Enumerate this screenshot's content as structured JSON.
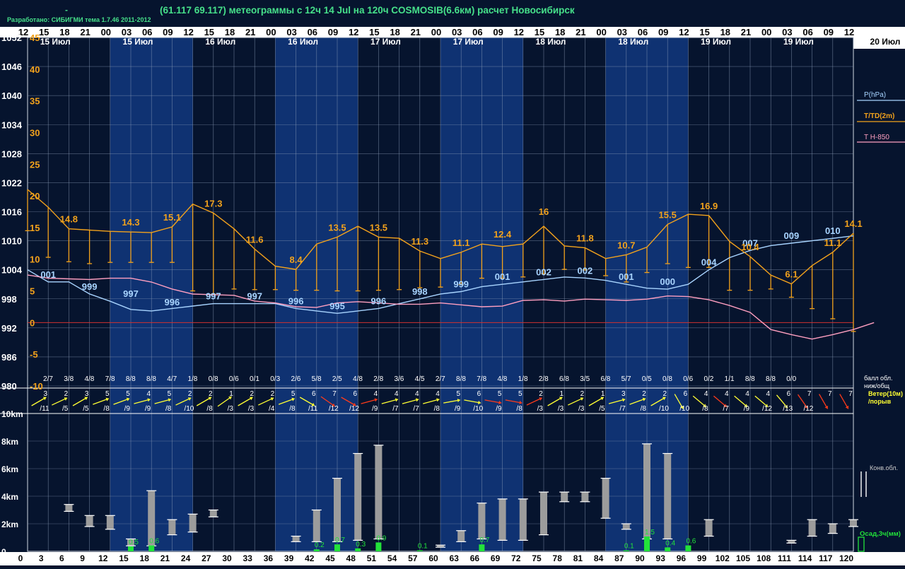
{
  "header": {
    "credit": "Разработано: СИБИГМИ тема 1.7.46 2011-2012",
    "dash": "-",
    "title": "(61.117 69.117) метеограммы с  12ч 14 Jul на 120ч COSMOSIB(6.6км) расчет Новосибирск"
  },
  "colors": {
    "background": "#06142e",
    "day_band": "#0f3272",
    "grid": "#8fa0bb",
    "pressure": "#a8d4ff",
    "temp": "#f2a21c",
    "t850": "#ff9fc0",
    "label": "#ffffff",
    "wind_normal": "#ffff33",
    "wind_strong": "#ff3b1a",
    "precip": "#22e23a",
    "cloud_bar": "#9c9c9c"
  },
  "chart_data": {
    "type": "line",
    "time_ticks": [
      "12",
      "15",
      "18",
      "21",
      "00",
      "03",
      "06",
      "09",
      "12",
      "15",
      "18",
      "21",
      "00",
      "03",
      "06",
      "09",
      "12",
      "15",
      "18",
      "21",
      "00",
      "03",
      "06",
      "09",
      "12",
      "15",
      "18",
      "21",
      "00",
      "03",
      "06",
      "09",
      "12",
      "15",
      "18",
      "21",
      "00",
      "03",
      "06",
      "09",
      "12"
    ],
    "date_labels": [
      {
        "text": "15 Июл",
        "tick": 1
      },
      {
        "text": "15 Июл",
        "tick": 5
      },
      {
        "text": "16 Июл",
        "tick": 9
      },
      {
        "text": "16 Июл",
        "tick": 13
      },
      {
        "text": "17 Июл",
        "tick": 17
      },
      {
        "text": "17 Июл",
        "tick": 21
      },
      {
        "text": "18 Июл",
        "tick": 25
      },
      {
        "text": "18 Июл",
        "tick": 29
      },
      {
        "text": "19 Июл",
        "tick": 33
      },
      {
        "text": "19 Июл",
        "tick": 37
      }
    ],
    "end_date_label": "20 Июл",
    "lead_hours": [
      0,
      3,
      6,
      9,
      12,
      15,
      18,
      21,
      24,
      27,
      30,
      33,
      36,
      39,
      42,
      45,
      48,
      51,
      54,
      57,
      60,
      63,
      66,
      69,
      72,
      75,
      78,
      81,
      84,
      87,
      90,
      93,
      96,
      99,
      102,
      105,
      108,
      111,
      114,
      117,
      120
    ],
    "pressure_axis": {
      "labels": [
        "1052",
        "1046",
        "1040",
        "1034",
        "1028",
        "1022",
        "1016",
        "1010",
        "1004",
        "998",
        "992",
        "986",
        "980"
      ],
      "range": [
        980,
        1052
      ]
    },
    "temp_axis": {
      "labels": [
        "45",
        "40",
        "35",
        "30",
        "25",
        "20",
        "15",
        "10",
        "5",
        "0",
        "-5",
        "-10"
      ],
      "range": [
        -10,
        45
      ]
    },
    "legend": {
      "pressure": "P(hPa)",
      "temp": "T/TD(2m)",
      "t850": "T H-850"
    },
    "series": [
      {
        "name": "P(hPa)",
        "values": [
          1004,
          1001.5,
          1001.5,
          999,
          997.5,
          995.8,
          995.5,
          996,
          996.5,
          997,
          997,
          997,
          997,
          996,
          995.5,
          995,
          995.5,
          996,
          997,
          998,
          999,
          999.5,
          1000.5,
          1001,
          1001.5,
          1002,
          1002.5,
          1002.3,
          1001.8,
          1001,
          1000.2,
          1000,
          1001,
          1004,
          1006.5,
          1008,
          1009,
          1009.5,
          1010,
          1010.5,
          1011
        ]
      },
      {
        "name": "T/TD(2m)",
        "values": [
          21,
          18.2,
          14.8,
          14.6,
          14.4,
          14.3,
          14.2,
          15.1,
          18.7,
          17.3,
          14.8,
          11.6,
          8.9,
          8.4,
          12.4,
          13.5,
          15.2,
          13.5,
          13.3,
          11.3,
          10.1,
          11.1,
          12.4,
          12.0,
          12.4,
          15.2,
          12.1,
          11.8,
          10.1,
          10.7,
          11.9,
          15.5,
          17.1,
          16.9,
          12.8,
          10.4,
          7.5,
          6.1,
          9.0,
          11.1,
          14.1
        ]
      },
      {
        "name": "T H-850",
        "values": [
          7.5,
          7.0,
          6.9,
          6.8,
          7.0,
          7.0,
          6.4,
          5.3,
          4.5,
          4.4,
          4.3,
          3.4,
          3.1,
          2.5,
          2.4,
          3.1,
          3.3,
          3.1,
          2.9,
          2.9,
          3.1,
          2.8,
          2.5,
          2.6,
          3.5,
          3.6,
          3.4,
          3.7,
          3.6,
          3.5,
          3.7,
          4.2,
          4.1,
          3.6,
          2.7,
          1.6,
          -1.1,
          -1.9,
          -2.6,
          -1.9,
          -1.1,
          0
        ]
      }
    ],
    "td_values": [
      14.5,
      10.3,
      9.6,
      9.3,
      9.5,
      9.5,
      9.5,
      9.5,
      5.0,
      4.5,
      5.3,
      5.2,
      5.2,
      5.1,
      5.1,
      5.0,
      5.0,
      5.1,
      5.2,
      5.5,
      5.6,
      6.0,
      7.0,
      7.0,
      7.2,
      7.7,
      8.4,
      8.3,
      7.4,
      6.4,
      7.9,
      9.3,
      8.7,
      8.7,
      5.1,
      5.1,
      5.3,
      4.0,
      2.2,
      0.6,
      -1.4
    ],
    "pressure_labels": [
      {
        "text": "001",
        "h": 3,
        "v": 1001.5
      },
      {
        "text": "999",
        "h": 9,
        "v": 999
      },
      {
        "text": "997",
        "h": 15,
        "v": 997.5
      },
      {
        "text": "996",
        "h": 21,
        "v": 995.8
      },
      {
        "text": "997",
        "h": 27,
        "v": 997
      },
      {
        "text": "997",
        "h": 33,
        "v": 997
      },
      {
        "text": "996",
        "h": 39,
        "v": 996
      },
      {
        "text": "995",
        "h": 45,
        "v": 995
      },
      {
        "text": "996",
        "h": 51,
        "v": 996
      },
      {
        "text": "998",
        "h": 57,
        "v": 998
      },
      {
        "text": "999",
        "h": 63,
        "v": 999.5
      },
      {
        "text": "001",
        "h": 69,
        "v": 1001
      },
      {
        "text": "002",
        "h": 75,
        "v": 1002
      },
      {
        "text": "002",
        "h": 81,
        "v": 1002.3
      },
      {
        "text": "001",
        "h": 87,
        "v": 1001
      },
      {
        "text": "000",
        "h": 93,
        "v": 1000
      },
      {
        "text": "004",
        "h": 99,
        "v": 1004
      },
      {
        "text": "007",
        "h": 105,
        "v": 1008
      },
      {
        "text": "009",
        "h": 111,
        "v": 1009.5
      },
      {
        "text": "010",
        "h": 117,
        "v": 1010.5
      }
    ],
    "temp_labels": [
      {
        "text": "14.8",
        "h": 6,
        "v": 14.8
      },
      {
        "text": "14.3",
        "h": 15,
        "v": 14.3
      },
      {
        "text": "15.1",
        "h": 21,
        "v": 15.1
      },
      {
        "text": "17.3",
        "h": 27,
        "v": 17.3
      },
      {
        "text": "11.6",
        "h": 33,
        "v": 11.6
      },
      {
        "text": "8.4",
        "h": 39,
        "v": 8.4
      },
      {
        "text": "13.5",
        "h": 45,
        "v": 13.5
      },
      {
        "text": "13.5",
        "h": 51,
        "v": 13.5
      },
      {
        "text": "11.3",
        "h": 57,
        "v": 11.3
      },
      {
        "text": "11.1",
        "h": 63,
        "v": 11.1
      },
      {
        "text": "12.4",
        "h": 69,
        "v": 12.4
      },
      {
        "text": "16",
        "h": 75,
        "v": 16
      },
      {
        "text": "11.8",
        "h": 81,
        "v": 11.8
      },
      {
        "text": "10.7",
        "h": 87,
        "v": 10.7
      },
      {
        "text": "15.5",
        "h": 93,
        "v": 15.5
      },
      {
        "text": "16.9",
        "h": 99,
        "v": 16.9
      },
      {
        "text": "10.4",
        "h": 105,
        "v": 10.4
      },
      {
        "text": "6.1",
        "h": 111,
        "v": 6.1
      },
      {
        "text": "11.1",
        "h": 117,
        "v": 11.1
      },
      {
        "text": "14.1",
        "h": 120,
        "v": 14.1
      }
    ],
    "cloud_cover": [
      "2/7",
      "3/8",
      "4/8",
      "7/8",
      "8/8",
      "8/8",
      "4/7",
      "1/8",
      "0/8",
      "0/6",
      "0/1",
      "0/3",
      "2/6",
      "5/8",
      "2/5",
      "4/8",
      "2/8",
      "3/6",
      "4/5",
      "2/7",
      "8/8",
      "7/8",
      "4/8",
      "1/8",
      "2/8",
      "6/8",
      "3/5",
      "6/8",
      "5/7",
      "0/5",
      "0/8",
      "0/6",
      "0/2",
      "1/1",
      "8/8",
      "8/8",
      "0/0"
    ],
    "cloud_legend": [
      "балл обл.",
      "ниж/общ"
    ],
    "wind": {
      "speed": [
        3,
        2,
        3,
        5,
        5,
        4,
        5,
        2,
        2,
        1,
        2,
        2,
        5,
        6,
        7,
        6,
        4,
        4,
        4,
        4,
        5,
        6,
        5,
        5,
        2,
        1,
        2,
        1,
        3,
        2,
        2,
        6,
        4,
        4,
        4,
        4,
        6,
        7,
        7,
        7
      ],
      "gust": [
        "/11",
        "/5",
        "/5",
        "/8",
        "/9",
        "/9",
        "/8",
        "/10",
        "/8",
        "/3",
        "/3",
        "/4",
        "/8",
        "/11",
        "/12",
        "/12",
        "/9",
        "/7",
        "/7",
        "/8",
        "/9",
        "/10",
        "/9",
        "/8",
        "/3",
        "/3",
        "/3",
        "/5",
        "/7",
        "/8",
        "/10",
        "/10",
        "/8",
        "/7",
        "/9",
        "/12",
        "/13",
        "/12"
      ],
      "strong": [
        14,
        15,
        16,
        22,
        23,
        24,
        33,
        37,
        38,
        39
      ],
      "dir": [
        30,
        25,
        30,
        20,
        20,
        15,
        15,
        25,
        30,
        35,
        30,
        25,
        20,
        -30,
        -35,
        -30,
        15,
        15,
        15,
        15,
        10,
        -10,
        -10,
        -10,
        25,
        30,
        25,
        30,
        15,
        20,
        30,
        -60,
        -40,
        -40,
        -40,
        -40,
        -50,
        -55,
        -60,
        -60
      ],
      "legend": [
        "Ветер(10м)",
        "/порыв"
      ]
    },
    "height_axis": {
      "labels": [
        "10km",
        "8km",
        "6km",
        "4km",
        "2km",
        "0"
      ],
      "range": [
        0,
        10
      ]
    },
    "cloud_bars": [
      {
        "h": 6,
        "lo": 2.9,
        "hi": 3.4
      },
      {
        "h": 9,
        "lo": 1.8,
        "hi": 2.6
      },
      {
        "h": 12,
        "lo": 1.6,
        "hi": 2.6
      },
      {
        "h": 15,
        "lo": 0.4,
        "hi": 0.9
      },
      {
        "h": 18,
        "lo": 0.4,
        "hi": 4.4
      },
      {
        "h": 21,
        "lo": 1.2,
        "hi": 2.3
      },
      {
        "h": 24,
        "lo": 1.4,
        "hi": 2.7
      },
      {
        "h": 27,
        "lo": 2.5,
        "hi": 3.0
      },
      {
        "h": 39,
        "lo": 0.7,
        "hi": 1.1
      },
      {
        "h": 42,
        "lo": 0.7,
        "hi": 3.0
      },
      {
        "h": 45,
        "lo": 0.7,
        "hi": 5.3
      },
      {
        "h": 48,
        "lo": 0.8,
        "hi": 7.1
      },
      {
        "h": 51,
        "lo": 0.9,
        "hi": 7.7
      },
      {
        "h": 60,
        "lo": 0.3,
        "hi": 0.45
      },
      {
        "h": 63,
        "lo": 0.7,
        "hi": 1.5
      },
      {
        "h": 66,
        "lo": 0.9,
        "hi": 3.5
      },
      {
        "h": 69,
        "lo": 0.8,
        "hi": 3.8
      },
      {
        "h": 72,
        "lo": 0.8,
        "hi": 3.8
      },
      {
        "h": 75,
        "lo": 1.2,
        "hi": 4.3
      },
      {
        "h": 78,
        "lo": 3.6,
        "hi": 4.3
      },
      {
        "h": 81,
        "lo": 3.6,
        "hi": 4.3
      },
      {
        "h": 84,
        "lo": 2.4,
        "hi": 5.3
      },
      {
        "h": 87,
        "lo": 1.6,
        "hi": 2.0
      },
      {
        "h": 90,
        "lo": 0.9,
        "hi": 7.8
      },
      {
        "h": 93,
        "lo": 0.9,
        "hi": 7.1
      },
      {
        "h": 99,
        "lo": 1.1,
        "hi": 2.3
      },
      {
        "h": 111,
        "lo": 0.6,
        "hi": 0.8
      },
      {
        "h": 114,
        "lo": 1.1,
        "hi": 2.3
      },
      {
        "h": 117,
        "lo": 1.3,
        "hi": 2.0
      },
      {
        "h": 120,
        "lo": 1.8,
        "hi": 2.3
      }
    ],
    "precip": [
      {
        "h": 15,
        "v": 0.5,
        "label": "0.5"
      },
      {
        "h": 18,
        "v": 0.6,
        "label": "0.6"
      },
      {
        "h": 42,
        "v": 0.2,
        "label": "0.2"
      },
      {
        "h": 45,
        "v": 0.7,
        "label": "0.7"
      },
      {
        "h": 48,
        "v": 0.3,
        "label": "0.3"
      },
      {
        "h": 51,
        "v": 0.9,
        "label": "0.9"
      },
      {
        "h": 57,
        "v": 0.1,
        "label": "0.1"
      },
      {
        "h": 66,
        "v": 0.7,
        "label": "0.7"
      },
      {
        "h": 87,
        "v": 0.1,
        "label": "0.1"
      },
      {
        "h": 90,
        "v": 1.5,
        "label": "1.5"
      },
      {
        "h": 93,
        "v": 0.4,
        "label": "0.4"
      },
      {
        "h": 96,
        "v": 0.6,
        "label": "0.6"
      }
    ],
    "bottom_legend": {
      "conv": "Конв.обл.",
      "precip": "Осад,3ч(мм)"
    }
  }
}
